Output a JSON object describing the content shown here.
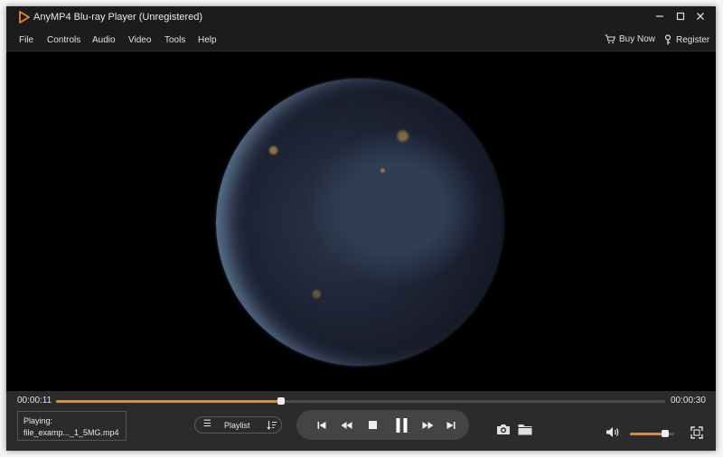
{
  "app": {
    "title": "AnyMP4 Blu-ray Player (Unregistered)",
    "accent_color": "#e88a1e"
  },
  "window_controls": {
    "minimize_icon": "minimize-icon",
    "maximize_icon": "maximize-icon",
    "close_icon": "close-icon"
  },
  "menu": {
    "items": [
      "File",
      "Controls",
      "Audio",
      "Video",
      "Tools",
      "Help"
    ],
    "buy_now": "Buy Now",
    "register": "Register"
  },
  "playback": {
    "current_time": "00:00:11",
    "total_time": "00:00:30",
    "progress": 0.37,
    "volume": 0.8
  },
  "now_playing": {
    "label": "Playing:",
    "file": "file_examp..._1_5MG.mp4"
  },
  "playlist": {
    "label": "Playlist"
  },
  "transport_icons": [
    "previous-icon",
    "rewind-icon",
    "stop-icon",
    "pause-icon",
    "fast-forward-icon",
    "next-icon"
  ],
  "tool_icons": [
    "camera-icon",
    "folder-icon",
    "volume-icon",
    "fullscreen-icon"
  ]
}
